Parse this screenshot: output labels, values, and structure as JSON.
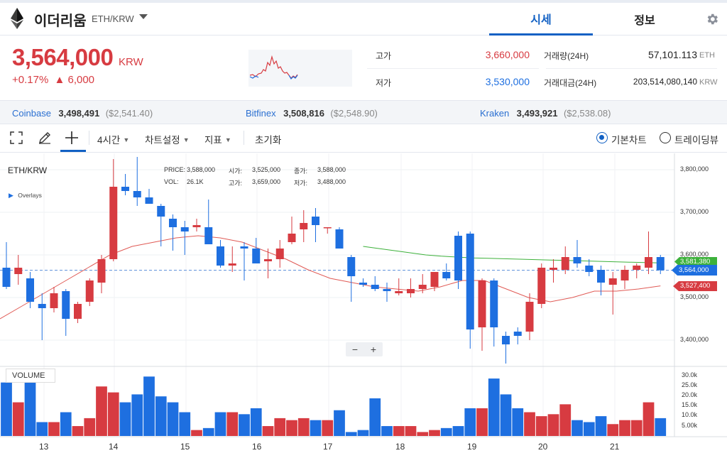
{
  "header": {
    "coin_name": "이더리움",
    "pair": "ETH/KRW",
    "tabs": [
      {
        "label": "시세",
        "active": true
      },
      {
        "label": "정보",
        "active": false
      }
    ]
  },
  "price": {
    "current": "3,564,000",
    "unit": "KRW",
    "change_pct": "+0.17%",
    "change_abs": "▲ 6,000",
    "high_label": "고가",
    "high": "3,660,000",
    "low_label": "저가",
    "low": "3,530,000",
    "volume_label": "거래량(24H)",
    "volume": "57,101.113",
    "volume_unit": "ETH",
    "amount_label": "거래대금(24H)",
    "amount": "203,514,080,140",
    "amount_unit": "KRW"
  },
  "exchanges": [
    {
      "name": "Coinbase",
      "krw": "3,498,491",
      "usd": "($2,541.40)"
    },
    {
      "name": "Bitfinex",
      "krw": "3,508,816",
      "usd": "($2,548.90)"
    },
    {
      "name": "Kraken",
      "krw": "3,493,921",
      "usd": "($2,538.08)"
    }
  ],
  "toolbar": {
    "interval": "4시간",
    "chart_settings": "차트설정",
    "indicators": "지표",
    "reset": "초기화",
    "basic_chart": "기본차트",
    "tradingview": "트레이딩뷰"
  },
  "chart": {
    "symbol": "ETH/KRW",
    "overlays": "Overlays",
    "info": {
      "price_label": "PRICE:",
      "price": "3,588,000",
      "open_label": "시가:",
      "open": "3,525,000",
      "close_label": "종가:",
      "close": "3,588,000",
      "vol_label": "VOL:",
      "vol": "26.1K",
      "high_label": "고가:",
      "high": "3,659,000",
      "low_label": "저가:",
      "low": "3,488,000"
    },
    "price_ticks": [
      "3,800,000",
      "3,700,000",
      "3,600,000",
      "3,500,000",
      "3,400,000"
    ],
    "volume_label": "VOLUME",
    "volume_ticks": [
      "30.0k",
      "25.0k",
      "20.0k",
      "15.0k",
      "10.0k",
      "5.00k"
    ],
    "x_ticks": [
      "13",
      "14",
      "15",
      "16",
      "17",
      "18",
      "19",
      "20",
      "21"
    ],
    "markers": [
      {
        "value": "3,581,380",
        "color": "#3db13b"
      },
      {
        "value": "3,564,000",
        "color": "#1e6fe0"
      },
      {
        "value": "3,527,400",
        "color": "#d73b41"
      }
    ],
    "zoom_minus": "−",
    "zoom_plus": "+",
    "colors": {
      "up": "#d73b41",
      "down": "#1e6fe0",
      "ma_long": "#3db13b",
      "ma_short": "#e05a55"
    }
  },
  "chart_data": {
    "type": "candlestick",
    "x_labels": [
      "13",
      "14",
      "15",
      "16",
      "17",
      "18",
      "19",
      "20",
      "21"
    ],
    "ylim": [
      3350000,
      3825000
    ],
    "candles": [
      {
        "o": 3570000,
        "h": 3630000,
        "l": 3520000,
        "c": 3525000
      },
      {
        "o": 3555000,
        "h": 3600000,
        "l": 3530000,
        "c": 3570000
      },
      {
        "o": 3545000,
        "h": 3560000,
        "l": 3475000,
        "c": 3490000
      },
      {
        "o": 3485000,
        "h": 3510000,
        "l": 3400000,
        "c": 3475000
      },
      {
        "o": 3475000,
        "h": 3525000,
        "l": 3465000,
        "c": 3510000
      },
      {
        "o": 3515000,
        "h": 3520000,
        "l": 3410000,
        "c": 3450000
      },
      {
        "o": 3450000,
        "h": 3490000,
        "l": 3440000,
        "c": 3485000
      },
      {
        "o": 3490000,
        "h": 3545000,
        "l": 3480000,
        "c": 3540000
      },
      {
        "o": 3535000,
        "h": 3600000,
        "l": 3510000,
        "c": 3590000
      },
      {
        "o": 3590000,
        "h": 3825000,
        "l": 3585000,
        "c": 3760000
      },
      {
        "o": 3760000,
        "h": 3790000,
        "l": 3740000,
        "c": 3750000
      },
      {
        "o": 3750000,
        "h": 3830000,
        "l": 3715000,
        "c": 3735000
      },
      {
        "o": 3735000,
        "h": 3755000,
        "l": 3720000,
        "c": 3720000
      },
      {
        "o": 3715000,
        "h": 3720000,
        "l": 3620000,
        "c": 3690000
      },
      {
        "o": 3685000,
        "h": 3695000,
        "l": 3610000,
        "c": 3665000
      },
      {
        "o": 3665000,
        "h": 3680000,
        "l": 3600000,
        "c": 3655000
      },
      {
        "o": 3665000,
        "h": 3685000,
        "l": 3655000,
        "c": 3670000
      },
      {
        "o": 3665000,
        "h": 3730000,
        "l": 3625000,
        "c": 3625000
      },
      {
        "o": 3620000,
        "h": 3635000,
        "l": 3570000,
        "c": 3575000
      },
      {
        "o": 3575000,
        "h": 3620000,
        "l": 3560000,
        "c": 3580000
      },
      {
        "o": 3620000,
        "h": 3630000,
        "l": 3540000,
        "c": 3615000
      },
      {
        "o": 3615000,
        "h": 3640000,
        "l": 3580000,
        "c": 3580000
      },
      {
        "o": 3585000,
        "h": 3615000,
        "l": 3545000,
        "c": 3590000
      },
      {
        "o": 3590000,
        "h": 3635000,
        "l": 3570000,
        "c": 3615000
      },
      {
        "o": 3630000,
        "h": 3690000,
        "l": 3625000,
        "c": 3650000
      },
      {
        "o": 3660000,
        "h": 3705000,
        "l": 3630000,
        "c": 3675000
      },
      {
        "o": 3690000,
        "h": 3710000,
        "l": 3630000,
        "c": 3670000
      },
      {
        "o": 3665000,
        "h": 3665000,
        "l": 3650000,
        "c": 3665000
      },
      {
        "o": 3660000,
        "h": 3665000,
        "l": 3615000,
        "c": 3615000
      },
      {
        "o": 3595000,
        "h": 3600000,
        "l": 3490000,
        "c": 3550000
      },
      {
        "o": 3535000,
        "h": 3545000,
        "l": 3525000,
        "c": 3530000
      },
      {
        "o": 3530000,
        "h": 3550000,
        "l": 3515000,
        "c": 3520000
      },
      {
        "o": 3520000,
        "h": 3535000,
        "l": 3490000,
        "c": 3515000
      },
      {
        "o": 3510000,
        "h": 3545000,
        "l": 3505000,
        "c": 3515000
      },
      {
        "o": 3510000,
        "h": 3545000,
        "l": 3500000,
        "c": 3520000
      },
      {
        "o": 3520000,
        "h": 3555000,
        "l": 3510000,
        "c": 3530000
      },
      {
        "o": 3525000,
        "h": 3560000,
        "l": 3515000,
        "c": 3560000
      },
      {
        "o": 3560000,
        "h": 3580000,
        "l": 3540000,
        "c": 3545000
      },
      {
        "o": 3645000,
        "h": 3655000,
        "l": 3520000,
        "c": 3540000
      },
      {
        "o": 3650000,
        "h": 3655000,
        "l": 3380000,
        "c": 3425000
      },
      {
        "o": 3430000,
        "h": 3545000,
        "l": 3375000,
        "c": 3540000
      },
      {
        "o": 3540000,
        "h": 3545000,
        "l": 3385000,
        "c": 3430000
      },
      {
        "o": 3410000,
        "h": 3420000,
        "l": 3345000,
        "c": 3390000
      },
      {
        "o": 3420000,
        "h": 3430000,
        "l": 3390000,
        "c": 3410000
      },
      {
        "o": 3420000,
        "h": 3510000,
        "l": 3400000,
        "c": 3490000
      },
      {
        "o": 3485000,
        "h": 3580000,
        "l": 3475000,
        "c": 3570000
      },
      {
        "o": 3565000,
        "h": 3590000,
        "l": 3535000,
        "c": 3570000
      },
      {
        "o": 3565000,
        "h": 3620000,
        "l": 3555000,
        "c": 3595000
      },
      {
        "o": 3595000,
        "h": 3635000,
        "l": 3570000,
        "c": 3580000
      },
      {
        "o": 3575000,
        "h": 3590000,
        "l": 3550000,
        "c": 3560000
      },
      {
        "o": 3565000,
        "h": 3575000,
        "l": 3505000,
        "c": 3535000
      },
      {
        "o": 3530000,
        "h": 3560000,
        "l": 3460000,
        "c": 3545000
      },
      {
        "o": 3540000,
        "h": 3575000,
        "l": 3520000,
        "c": 3565000
      },
      {
        "o": 3565000,
        "h": 3580000,
        "l": 3545000,
        "c": 3575000
      },
      {
        "o": 3570000,
        "h": 3655000,
        "l": 3555000,
        "c": 3595000
      },
      {
        "o": 3595000,
        "h": 3600000,
        "l": 3555000,
        "c": 3564000
      }
    ],
    "ma_long": [
      3620000,
      3615000,
      3610000,
      3605000,
      3600000,
      3597000,
      3595000,
      3593000,
      3592000,
      3591000,
      3590000,
      3589000,
      3588000,
      3587000,
      3586000,
      3585000,
      3584000,
      3583000,
      3582000,
      3581380
    ],
    "ma_short": [
      3450000,
      3480000,
      3510000,
      3540000,
      3570000,
      3600000,
      3620000,
      3630000,
      3640000,
      3645000,
      3640000,
      3630000,
      3610000,
      3590000,
      3565000,
      3545000,
      3535000,
      3525000,
      3520000,
      3515000,
      3525000,
      3540000,
      3540000,
      3520000,
      3500000,
      3490000,
      3500000,
      3515000,
      3515000,
      3520000,
      3527400
    ],
    "volumes": [
      27,
      17,
      27,
      7,
      7,
      12,
      5,
      9,
      25,
      22,
      17,
      21,
      30,
      20,
      17,
      12,
      3,
      4,
      12,
      12,
      11,
      14,
      5,
      9,
      8,
      9,
      8,
      8,
      13,
      2,
      3,
      19,
      5,
      5,
      5,
      2,
      3,
      4,
      5,
      14,
      14,
      29,
      21,
      14,
      12,
      10,
      11,
      16,
      8,
      7,
      10,
      6,
      8,
      8,
      17,
      9
    ]
  }
}
